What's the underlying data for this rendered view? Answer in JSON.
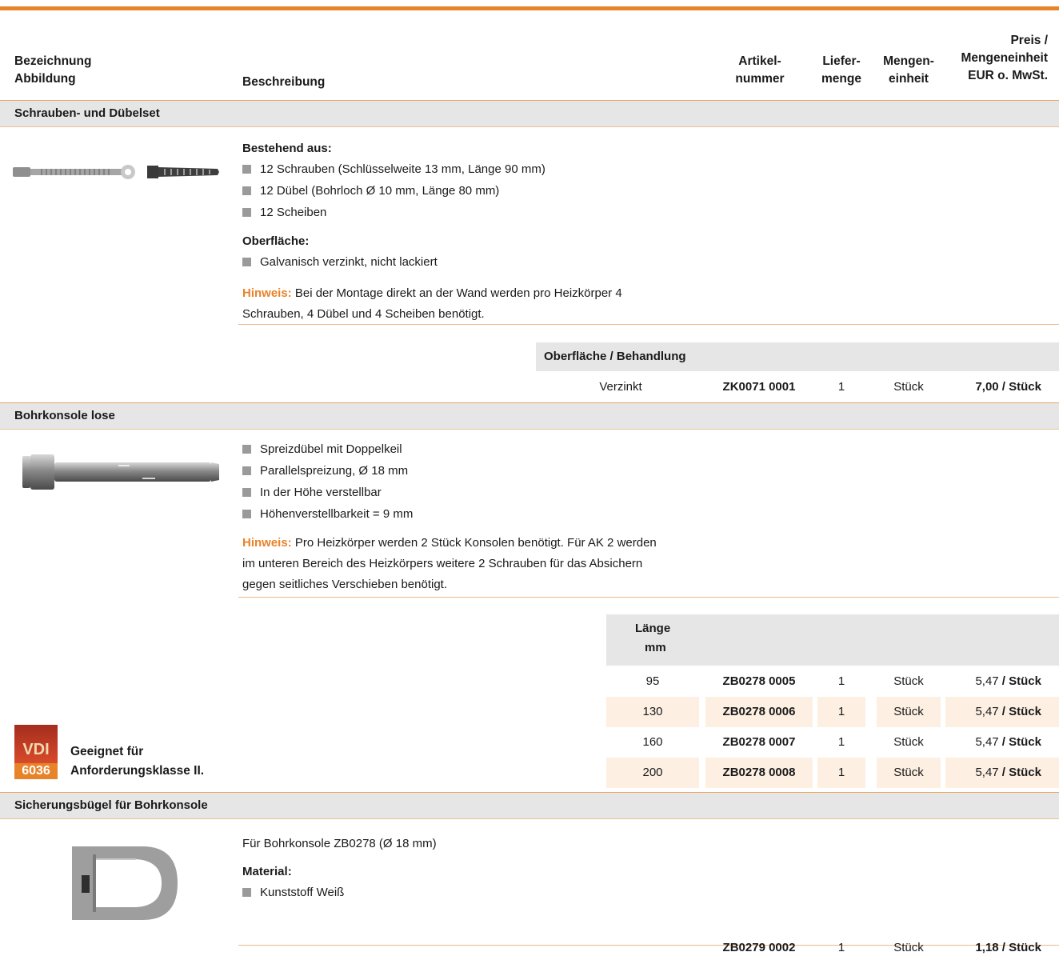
{
  "header": {
    "col1_line1": "Bezeichnung",
    "col1_line2": "Abbildung",
    "col2": "Beschreibung",
    "col3_line1": "Artikel-",
    "col3_line2": "nummer",
    "col4_line1": "Liefer-",
    "col4_line2": "menge",
    "col5_line1": "Mengen-",
    "col5_line2": "einheit",
    "col6_line1": "Preis /",
    "col6_line2": "Mengeneinheit",
    "col6_line3": "EUR o. MwSt."
  },
  "section1": {
    "title": "Schrauben- und Dübelset",
    "label_consists": "Bestehend aus:",
    "items": [
      "12 Schrauben (Schlüsselweite 13 mm, Länge 90 mm)",
      "12 Dübel (Bohrloch Ø 10 mm, Länge 80 mm)",
      "12 Scheiben"
    ],
    "label_surface": "Oberfläche:",
    "surface_items": [
      "Galvanisch verzinkt, nicht lackiert"
    ],
    "hint_label": "Hinweis:",
    "hint_text_1": " Bei der Montage direkt an der Wand werden pro Heizkörper 4",
    "hint_text_2": "Schrauben, 4 Dübel und 4 Scheiben benötigt.",
    "sub_header": "Oberfläche / Behandlung",
    "row": {
      "variant": "Verzinkt",
      "article": "ZK0071 0001",
      "qty": "1",
      "unit": "Stück",
      "price": "7,00",
      "per": " / Stück"
    }
  },
  "section2": {
    "title": "Bohrkonsole lose",
    "items": [
      "Spreizdübel mit Doppelkeil",
      "Parallelspreizung, Ø 18 mm",
      "In der Höhe verstellbar",
      "Höhenverstellbarkeit = 9 mm"
    ],
    "hint_label": "Hinweis:",
    "hint_text_1": " Pro Heizkörper werden 2 Stück Konsolen benötigt. Für AK 2 werden",
    "hint_text_2": "im unteren Bereich des Heizkörpers weitere 2 Schrauben für das Absichern",
    "hint_text_3": "gegen seitliches Verschieben benötigt.",
    "sub_header_1": "Länge",
    "sub_header_2": "mm",
    "rows": [
      {
        "length": "95",
        "article": "ZB0278 0005",
        "qty": "1",
        "unit": "Stück",
        "price": "5,47",
        "per": " / Stück"
      },
      {
        "length": "130",
        "article": "ZB0278 0006",
        "qty": "1",
        "unit": "Stück",
        "price": "5,47",
        "per": " / Stück"
      },
      {
        "length": "160",
        "article": "ZB0278 0007",
        "qty": "1",
        "unit": "Stück",
        "price": "5,47",
        "per": " / Stück"
      },
      {
        "length": "200",
        "article": "ZB0278 0008",
        "qty": "1",
        "unit": "Stück",
        "price": "5,47",
        "per": " / Stück"
      }
    ],
    "vdi_top": "VDI",
    "vdi_bottom": "6036",
    "vdi_text_1": "Geeignet für",
    "vdi_text_2": "Anforderungsklasse II."
  },
  "section3": {
    "title": "Sicherungsbügel für Bohrkonsole",
    "desc": "Für Bohrkonsole ZB0278 (Ø 18 mm)",
    "label_material": "Material:",
    "items": [
      "Kunststoff Weiß"
    ],
    "row": {
      "article": "ZB0279 0002",
      "qty": "1",
      "unit": "Stück",
      "price": "1,18",
      "per": " / Stück"
    }
  },
  "colors": {
    "accent": "#e8832a",
    "shade": "#fdf0e3",
    "header_gray": "#e6e6e6"
  }
}
